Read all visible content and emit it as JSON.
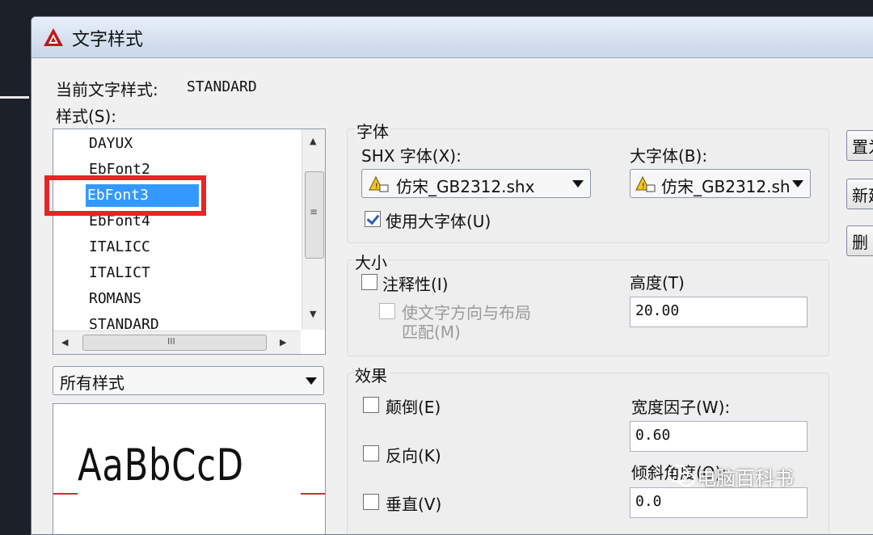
{
  "window": {
    "title": "文字样式"
  },
  "current_style": {
    "label": "当前文字样式:",
    "value": "STANDARD"
  },
  "styles": {
    "label": "样式(S):",
    "items": [
      "DAYUX",
      "EbFont2",
      "EbFont3",
      "EbFont4",
      "ITALICC",
      "ITALICT",
      "ROMANS",
      "STANDARD"
    ],
    "selected": "EbFont3",
    "filter_value": "所有样式"
  },
  "font": {
    "group_label": "字体",
    "shx_label": "SHX 字体(X):",
    "shx_value": "仿宋_GB2312.shx",
    "bigfont_label": "大字体(B):",
    "bigfont_value": "仿宋_GB2312.sh",
    "use_bigfont_label": "使用大字体(U)"
  },
  "size": {
    "group_label": "大小",
    "annotative_label": "注释性(I)",
    "match_orientation_label_1": "使文字方向与布局",
    "match_orientation_label_2": "匹配(M)",
    "height_label": "高度(T)",
    "height_value": "20.00"
  },
  "effects": {
    "group_label": "效果",
    "upside_down_label": "颠倒(E)",
    "backwards_label": "反向(K)",
    "vertical_label": "垂直(V)",
    "width_factor_label": "宽度因子(W):",
    "width_factor_value": "0.60",
    "oblique_label": "倾斜角度(O):",
    "oblique_value": "0.0"
  },
  "buttons": {
    "set_current": "置为",
    "new": "新建",
    "delete": "删"
  },
  "preview": {
    "text": "AaBbCcD"
  },
  "watermark": {
    "text": "电脑百科书"
  }
}
